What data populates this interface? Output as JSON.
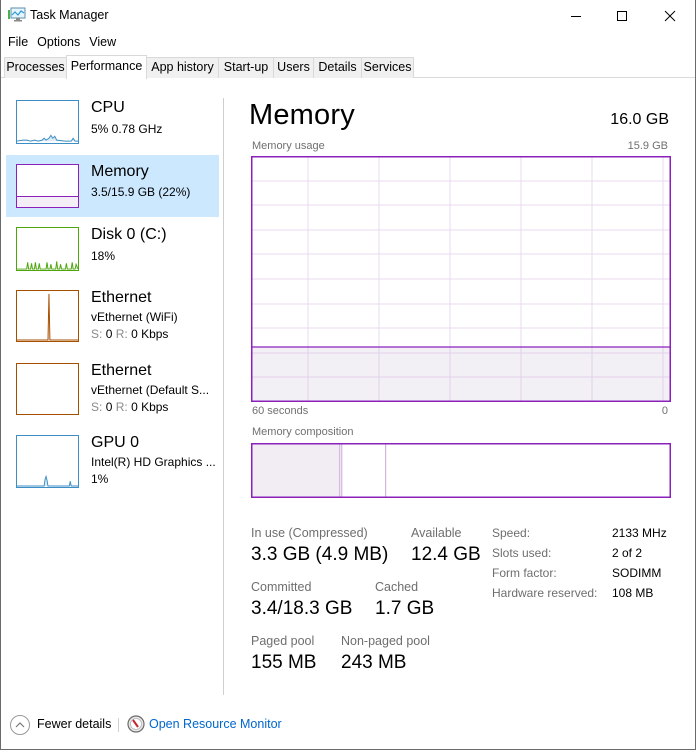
{
  "window": {
    "title": "Task Manager",
    "controls": {
      "minimize": "minimize",
      "maximize": "maximize",
      "close": "close"
    }
  },
  "menu": [
    "File",
    "Options",
    "View"
  ],
  "tabs": [
    {
      "label": "Processes",
      "active": false
    },
    {
      "label": "Performance",
      "active": true
    },
    {
      "label": "App history",
      "active": false
    },
    {
      "label": "Start-up",
      "active": false
    },
    {
      "label": "Users",
      "active": false
    },
    {
      "label": "Details",
      "active": false
    },
    {
      "label": "Services",
      "active": false
    }
  ],
  "sidebar": {
    "items": [
      {
        "title": "CPU",
        "line1": "5%  0.78 GHz",
        "line2": null,
        "color": "#3c8ec4",
        "selected": false
      },
      {
        "title": "Memory",
        "line1": "3.5/15.9 GB (22%)",
        "line2": null,
        "color": "#8b20bb",
        "selected": true
      },
      {
        "title": "Disk 0 (C:)",
        "line1": "18%",
        "line2": null,
        "color": "#4da60c",
        "selected": false
      },
      {
        "title": "Ethernet",
        "line1": "vEthernet (WiFi)",
        "line2_s": "S:",
        "line2_sv": "0",
        "line2_r": "R:",
        "line2_rv": "0 Kbps",
        "color": "#a74f01",
        "selected": false
      },
      {
        "title": "Ethernet",
        "line1": "vEthernet (Default S...",
        "line2_s": "S:",
        "line2_sv": "0",
        "line2_r": "R:",
        "line2_rv": "0 Kbps",
        "color": "#a74f01",
        "selected": false
      },
      {
        "title": "GPU 0",
        "line1": "Intel(R) HD Graphics ...",
        "line2": "1%",
        "color": "#3c8ec4",
        "selected": false
      }
    ]
  },
  "main": {
    "title": "Memory",
    "total": "16.0 GB",
    "usage_label": "Memory usage",
    "usage_max": "15.9 GB",
    "time_left": "60 seconds",
    "time_right": "0",
    "composition_label": "Memory composition",
    "accent": "#8b20bb",
    "usage_fraction": 0.22,
    "composition": {
      "in_use_fraction": 0.21,
      "modified_fraction": 0.004,
      "standby_fraction": 0.105
    },
    "stats": {
      "in_use_label": "In use (Compressed)",
      "in_use_value": "3.3 GB (4.9 MB)",
      "available_label": "Available",
      "available_value": "12.4 GB",
      "committed_label": "Committed",
      "committed_value": "3.4/18.3 GB",
      "cached_label": "Cached",
      "cached_value": "1.7 GB",
      "paged_label": "Paged pool",
      "paged_value": "155 MB",
      "nonpaged_label": "Non-paged pool",
      "nonpaged_value": "243 MB"
    },
    "specs": [
      {
        "label": "Speed:",
        "value": "2133 MHz"
      },
      {
        "label": "Slots used:",
        "value": "2 of 2"
      },
      {
        "label": "Form factor:",
        "value": "SODIMM"
      },
      {
        "label": "Hardware reserved:",
        "value": "108 MB"
      }
    ]
  },
  "footer": {
    "fewer_details": "Fewer details",
    "open_resource_monitor": "Open Resource Monitor"
  }
}
